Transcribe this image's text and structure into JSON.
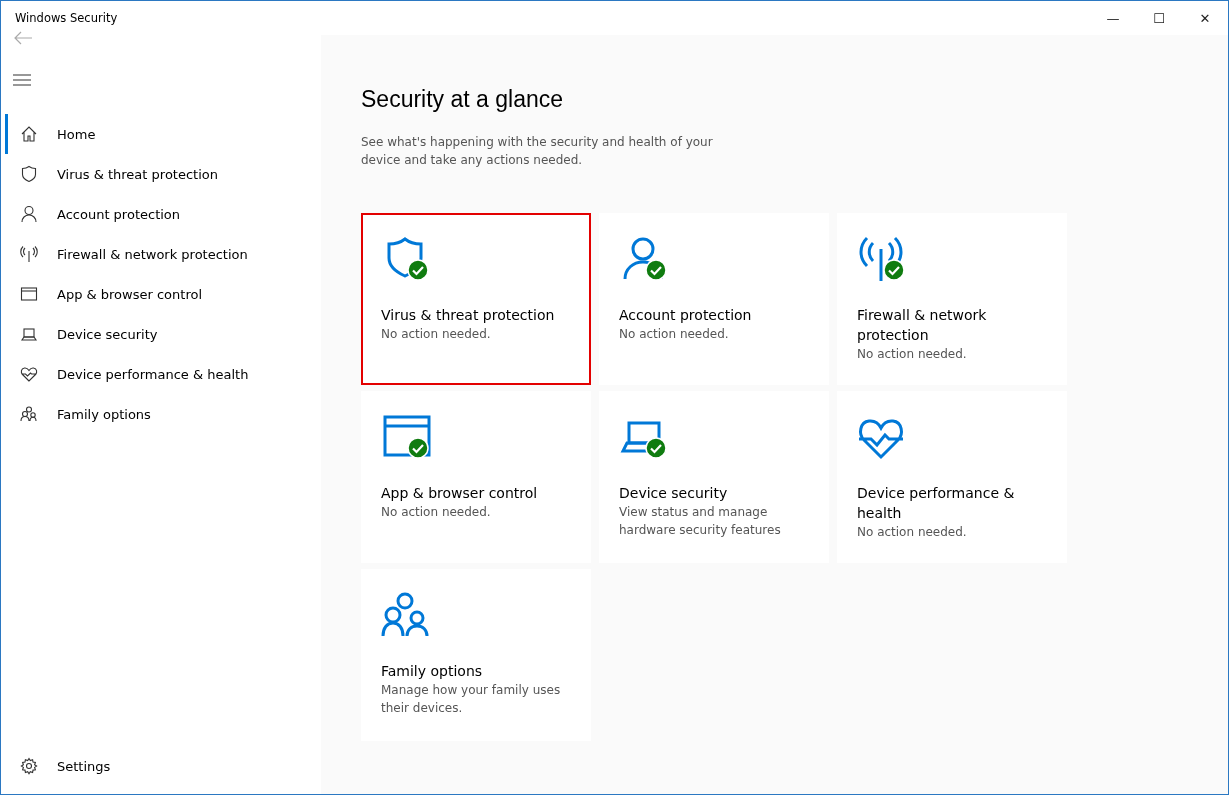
{
  "window": {
    "title": "Windows Security",
    "controls": [
      "—",
      "☐",
      "✕"
    ]
  },
  "sidebar": {
    "items": [
      {
        "label": "Home",
        "selected": true
      },
      {
        "label": "Virus & threat protection",
        "selected": false
      },
      {
        "label": "Account protection",
        "selected": false
      },
      {
        "label": "Firewall & network protection",
        "selected": false
      },
      {
        "label": "App & browser control",
        "selected": false
      },
      {
        "label": "Device security",
        "selected": false
      },
      {
        "label": "Device performance & health",
        "selected": false
      },
      {
        "label": "Family options",
        "selected": false
      }
    ],
    "settings": {
      "label": "Settings"
    }
  },
  "main": {
    "heading": "Security at a glance",
    "intro": "See what's happening with the security and health of your device and take any actions needed.",
    "tiles": [
      {
        "title": "Virus & threat protection",
        "status": "No action needed.",
        "ok": true,
        "highlighted": true
      },
      {
        "title": "Account protection",
        "status": "No action needed.",
        "ok": true,
        "highlighted": false
      },
      {
        "title": "Firewall & network protection",
        "status": "No action needed.",
        "ok": true,
        "highlighted": false
      },
      {
        "title": "App & browser control",
        "status": "No action needed.",
        "ok": true,
        "highlighted": false
      },
      {
        "title": "Device security",
        "status": "View status and manage hardware security features",
        "ok": true,
        "highlighted": false
      },
      {
        "title": "Device performance & health",
        "status": "No action needed.",
        "ok": false,
        "highlighted": false
      },
      {
        "title": "Family options",
        "status": "Manage how your family uses their devices.",
        "ok": false,
        "highlighted": false
      }
    ]
  }
}
